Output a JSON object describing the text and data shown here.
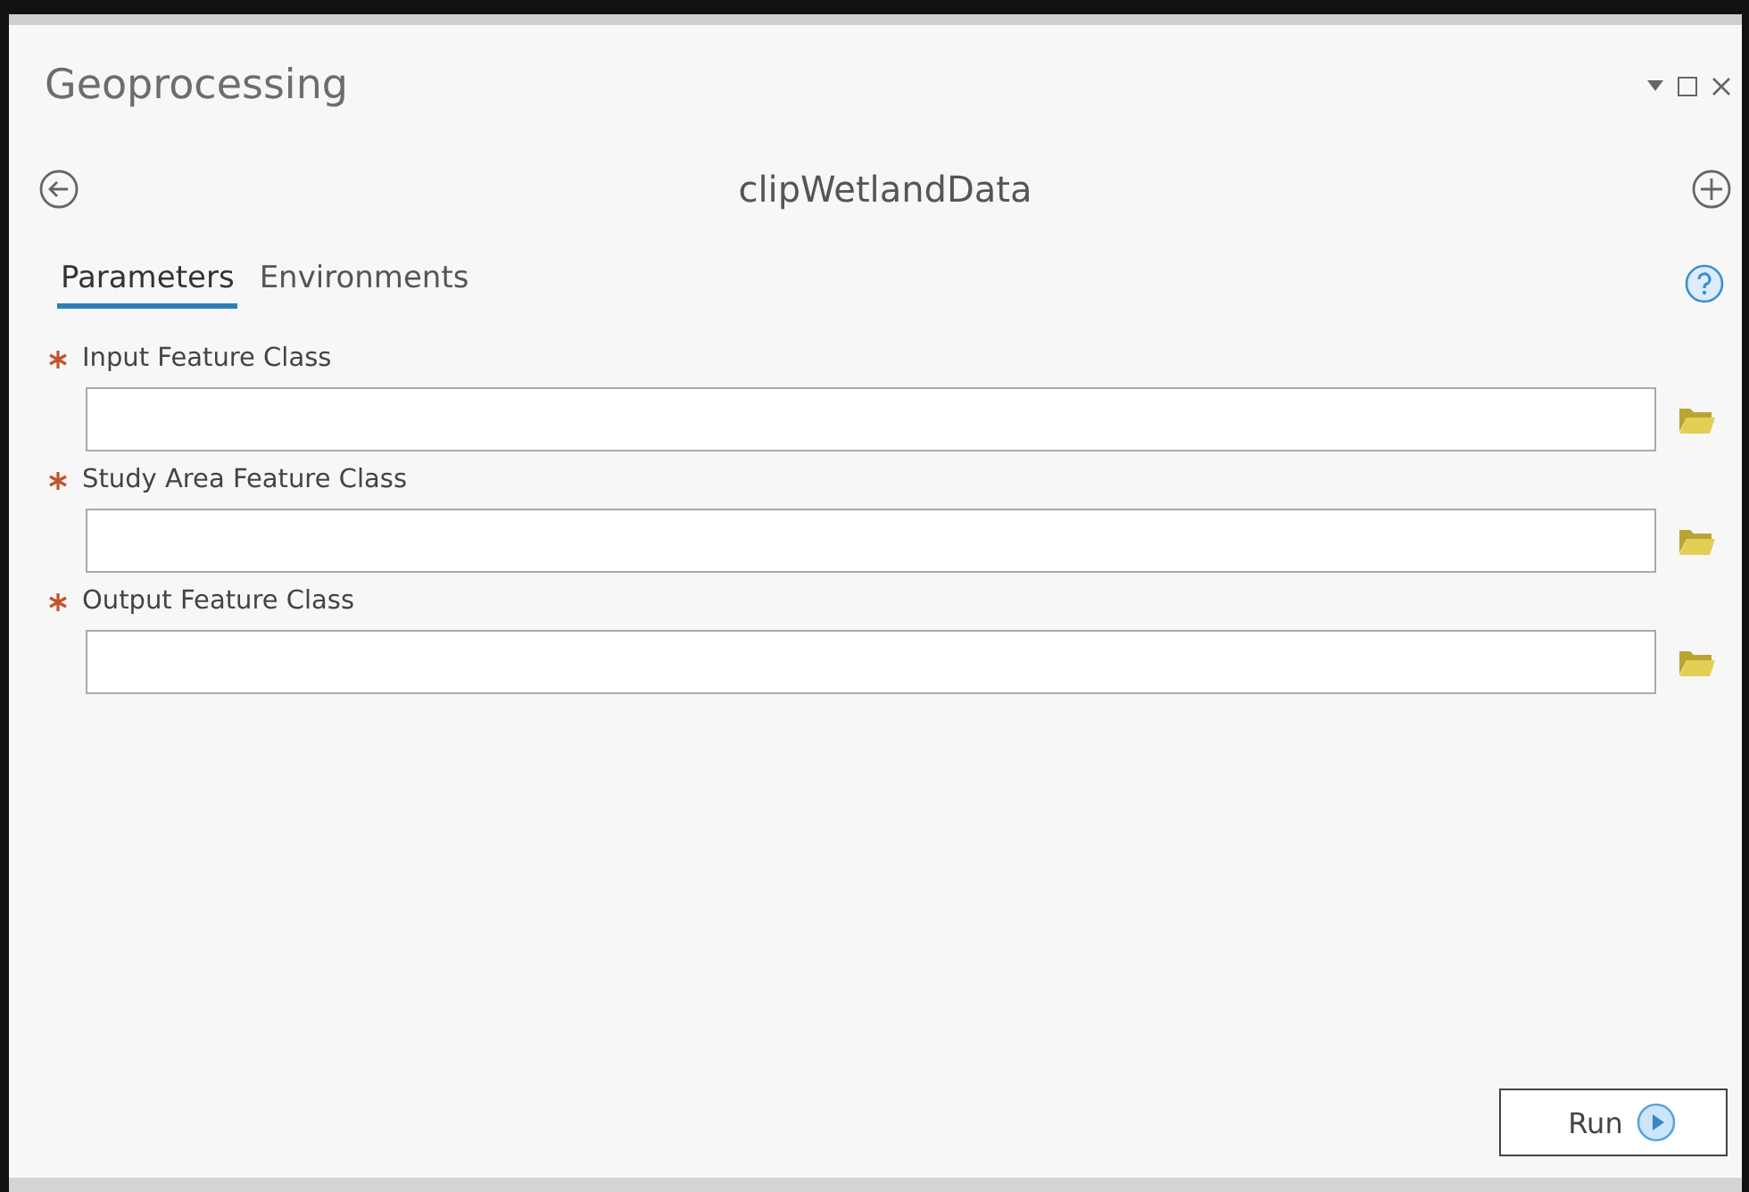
{
  "window": {
    "title": "Geoprocessing"
  },
  "tool": {
    "name": "clipWetlandData"
  },
  "tabs": [
    {
      "label": "Parameters",
      "selected": true
    },
    {
      "label": "Environments",
      "selected": false
    }
  ],
  "parameters": [
    {
      "label": "Input Feature Class",
      "required": true
    },
    {
      "label": "Study Area Feature Class",
      "required": true
    },
    {
      "label": "Output Feature Class",
      "required": true
    }
  ],
  "run_button": {
    "label": "Run"
  }
}
